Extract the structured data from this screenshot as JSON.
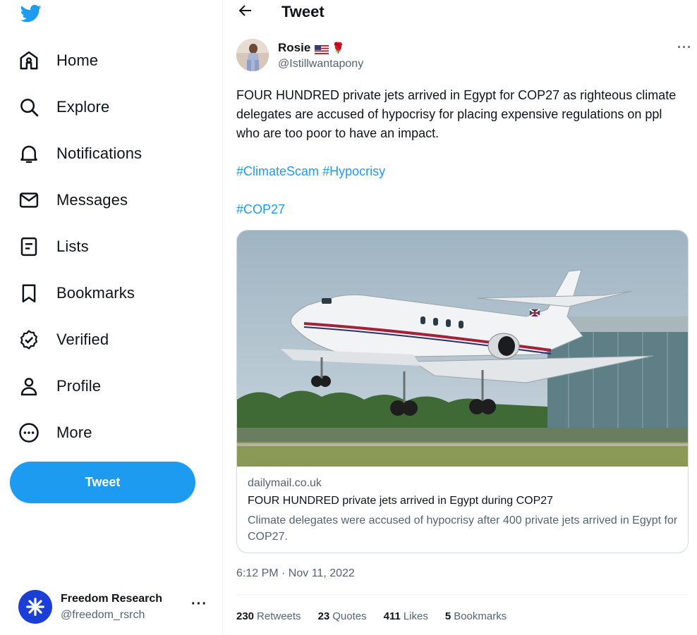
{
  "colors": {
    "accent": "#1d9bf0",
    "text": "#0f1419",
    "muted": "#536471",
    "border": "#cfd9de"
  },
  "sidebar": {
    "logo": "twitter-bird-icon",
    "items": [
      {
        "label": "Home",
        "icon": "home-icon"
      },
      {
        "label": "Explore",
        "icon": "search-icon"
      },
      {
        "label": "Notifications",
        "icon": "bell-icon"
      },
      {
        "label": "Messages",
        "icon": "envelope-icon"
      },
      {
        "label": "Lists",
        "icon": "list-icon"
      },
      {
        "label": "Bookmarks",
        "icon": "bookmark-icon"
      },
      {
        "label": "Verified",
        "icon": "verified-icon"
      },
      {
        "label": "Profile",
        "icon": "person-icon"
      },
      {
        "label": "More",
        "icon": "more-circle-icon"
      }
    ],
    "tweet_button": "Tweet",
    "account": {
      "name": "Freedom Research",
      "handle": "@freedom_rsrch",
      "more": "···"
    }
  },
  "header": {
    "title": "Tweet",
    "back_icon": "arrow-left-icon"
  },
  "tweet": {
    "author": {
      "name": "Rosie",
      "handle": "@Istillwantapony",
      "emoji": "🌹"
    },
    "more": "···",
    "text": "FOUR HUNDRED private jets arrived in Egypt for COP27 as righteous climate delegates are accused of hypocrisy for placing expensive regulations on ppl who are too poor to have an impact.",
    "hashtags_line1": [
      "#ClimateScam",
      "#Hypocrisy"
    ],
    "hashtags_line2": [
      "#COP27"
    ],
    "card": {
      "domain": "dailymail.co.uk",
      "title": "FOUR HUNDRED private jets arrived in Egypt during COP27",
      "description": "Climate delegates were accused of hypocrisy after 400 private jets arrived in Egypt for COP27."
    },
    "timestamp": "6:12 PM · Nov 11, 2022",
    "stats": [
      {
        "count": "230",
        "label": "Retweets"
      },
      {
        "count": "23",
        "label": "Quotes"
      },
      {
        "count": "411",
        "label": "Likes"
      },
      {
        "count": "5",
        "label": "Bookmarks"
      }
    ]
  }
}
